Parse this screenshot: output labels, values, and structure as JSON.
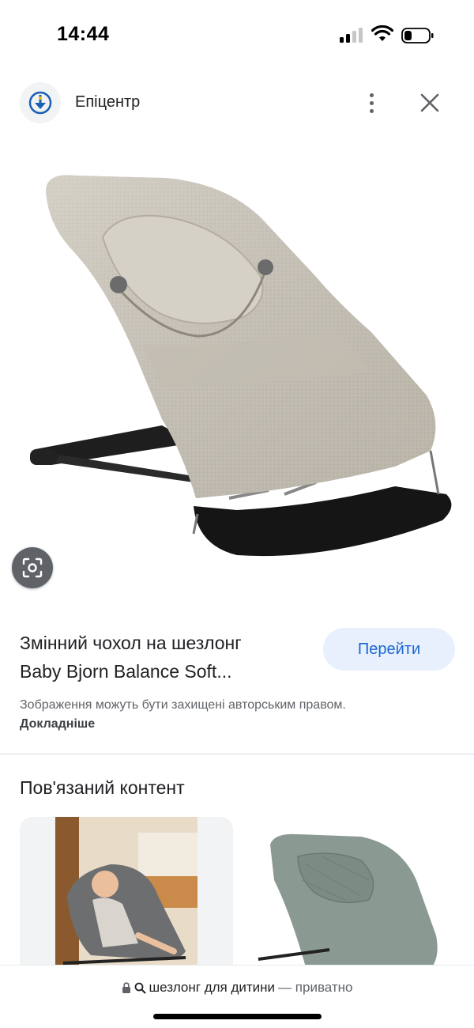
{
  "status_bar": {
    "time": "14:44",
    "icons": [
      "cellular-signal-icon",
      "wifi-icon",
      "battery-icon"
    ]
  },
  "header": {
    "source_name": "Епіцентр",
    "logo_icon": "epicenter-logo-icon",
    "more_icon": "more-vert-icon",
    "close_icon": "close-icon"
  },
  "product": {
    "title_line1": "Змінний чохол на шезлонг",
    "title_line2": "Baby Bjorn Balance Soft...",
    "visit_label": "Перейти",
    "copyright_text": "Зображення можуть бути захищені авторським правом.",
    "learn_more_label": "Докладніше"
  },
  "related": {
    "title": "Пов'язаний контент"
  },
  "address_bar": {
    "query": "шезлонг для дитини",
    "suffix": "— приватно",
    "icons": [
      "lock-icon",
      "search-icon"
    ]
  },
  "colors": {
    "accent": "#1967d2",
    "button_bg": "#e8f0fe",
    "logo_blue": "#1a5fb4"
  }
}
